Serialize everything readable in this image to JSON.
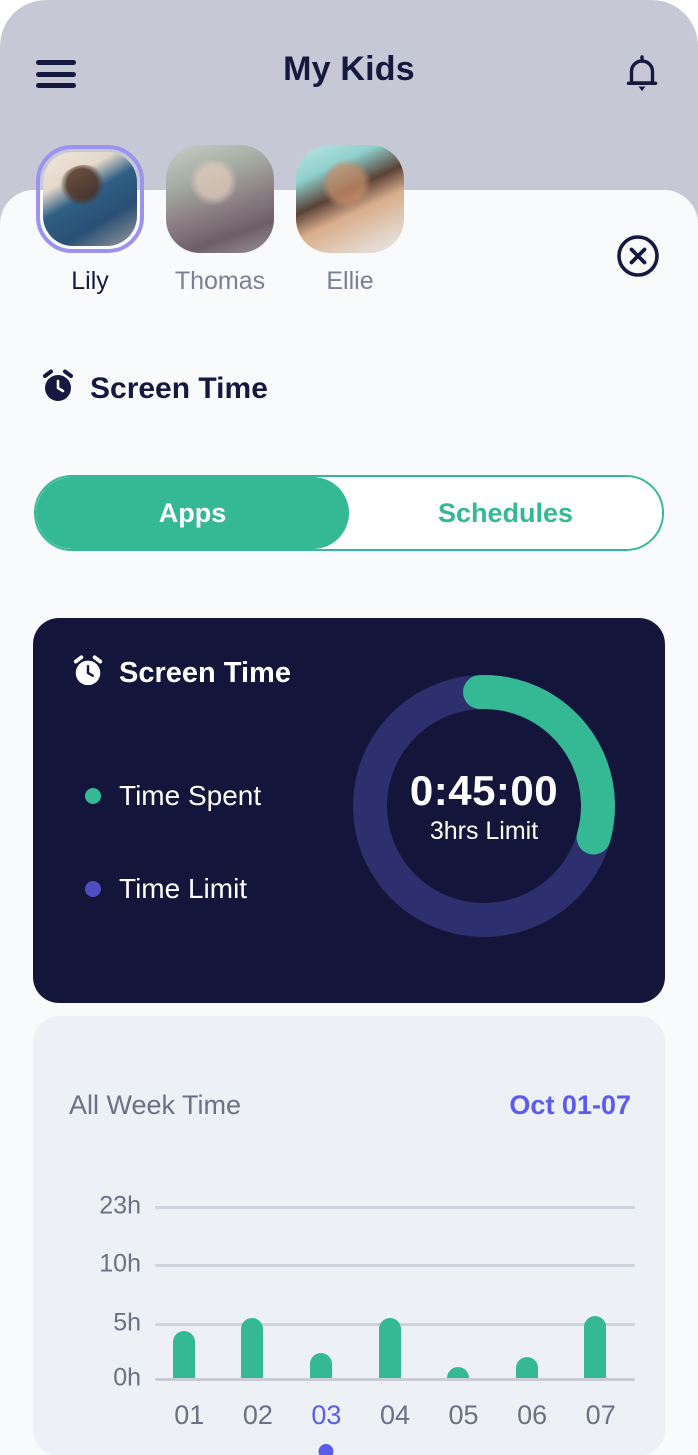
{
  "header": {
    "title": "My Kids",
    "menu_icon": "hamburger-menu-icon",
    "bell_icon": "notification-bell-icon"
  },
  "kids": {
    "items": [
      {
        "name": "Lily",
        "selected": true
      },
      {
        "name": "Thomas",
        "selected": false
      },
      {
        "name": "Ellie",
        "selected": false
      }
    ],
    "close_icon": "close-circle-icon"
  },
  "section": {
    "title": "Screen Time",
    "icon": "alarm-clock-icon"
  },
  "segmented": {
    "options": [
      {
        "label": "Apps",
        "active": true
      },
      {
        "label": "Schedules",
        "active": false
      }
    ]
  },
  "screen_time_card": {
    "title": "Screen Time",
    "icon": "alarm-clock-icon",
    "legend": [
      {
        "label": "Time Spent",
        "color": "#35b894"
      },
      {
        "label": "Time Limit",
        "color": "#4e4ec0"
      }
    ],
    "donut": {
      "time": "0:45:00",
      "limit_label": "3hrs Limit",
      "spent_percent": 30,
      "track_color": "#2d2f6e",
      "progress_color": "#35b894"
    }
  },
  "week_card": {
    "title": "All Week Time",
    "range": "Oct 01-07",
    "range_color": "#5b5bec",
    "active_day": "03"
  },
  "chart_data": {
    "type": "bar",
    "title": "All Week Time",
    "subtitle": "Oct 01-07",
    "categories": [
      "01",
      "02",
      "03",
      "04",
      "05",
      "06",
      "07"
    ],
    "values": [
      4.3,
      5.5,
      2.3,
      5.5,
      1.0,
      1.9,
      5.6
    ],
    "unit": "h",
    "xlabel": "",
    "ylabel": "",
    "ytick_labels": [
      "23h",
      "10h",
      "5h",
      "0h"
    ],
    "ytick_values": [
      23,
      10,
      5,
      0
    ],
    "ylim": [
      0,
      23
    ],
    "grid": true,
    "legend": false,
    "bar_color": "#35b894",
    "highlight_category": "03",
    "highlight_color": "#5b5bec"
  },
  "colors": {
    "accent_green": "#35b894",
    "accent_purple": "#5b5bec",
    "navy": "#16193f",
    "card_dark": "#13163a",
    "header_bg": "#c6c9d5",
    "page_bg": "#f9fafc",
    "chart_card_bg": "#edf0f5",
    "muted_text": "#6b7085"
  }
}
